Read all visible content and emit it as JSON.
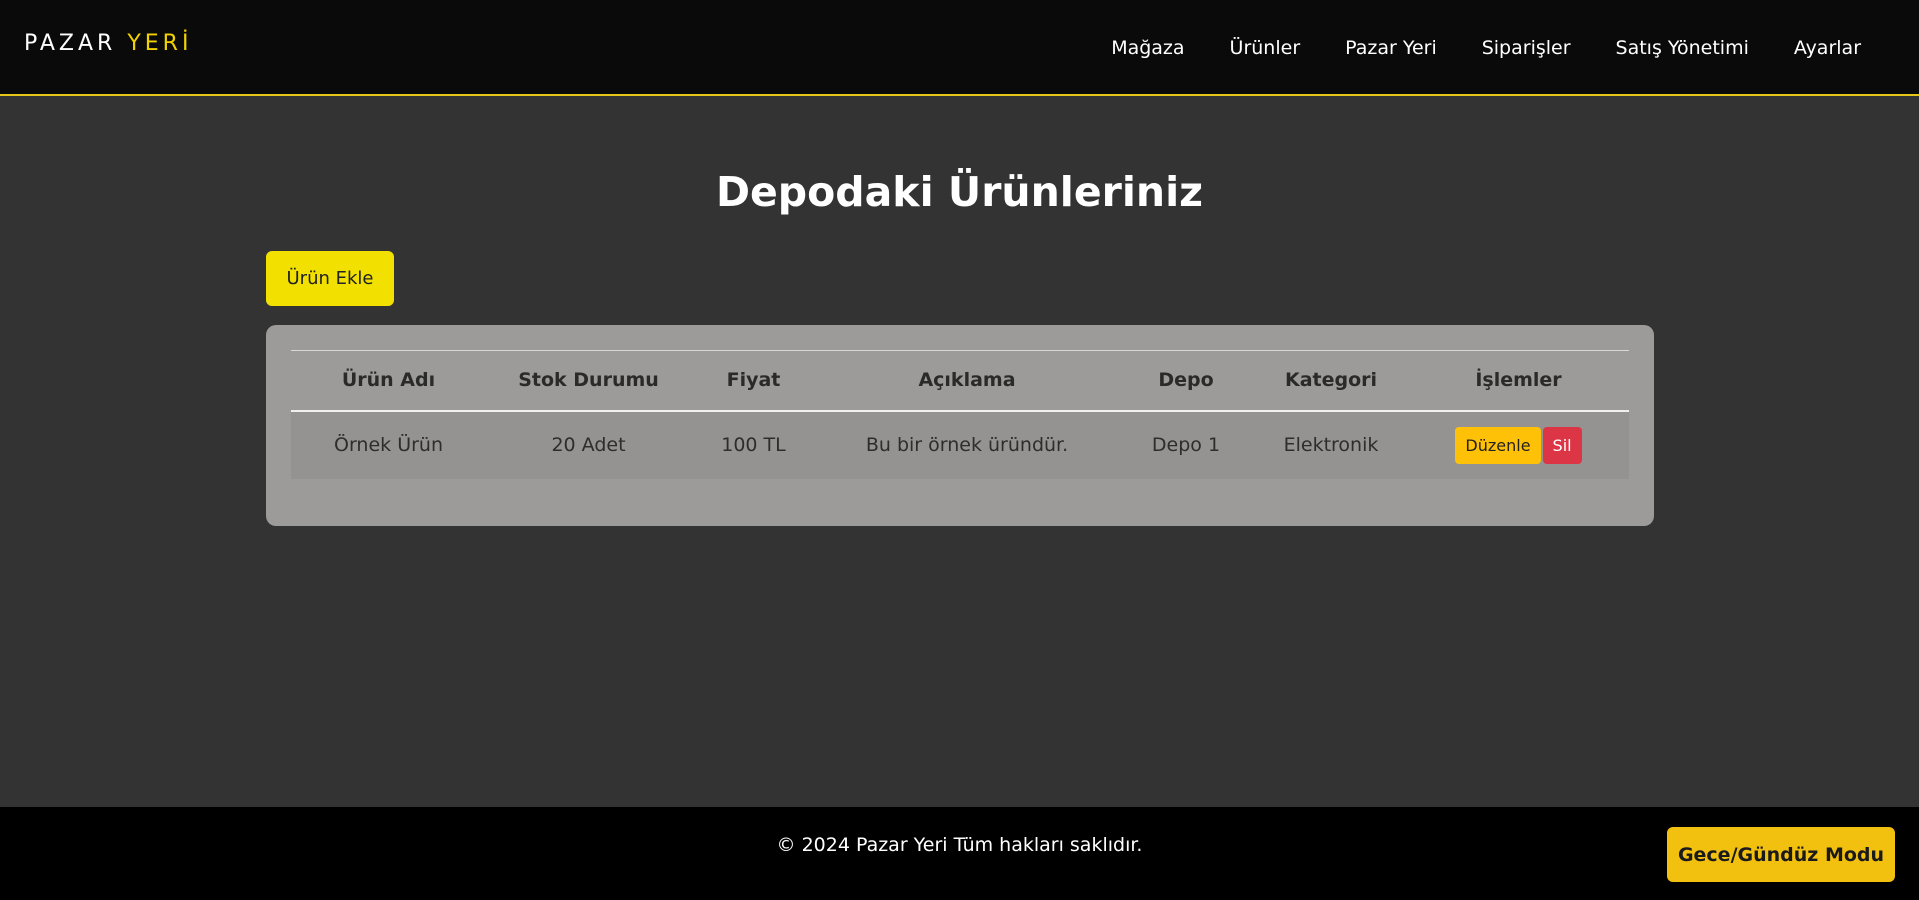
{
  "header": {
    "logo_main": "PAZAR",
    "logo_accent": "YERİ",
    "nav": [
      "Mağaza",
      "Ürünler",
      "Pazar Yeri",
      "Siparişler",
      "Satış Yönetimi",
      "Ayarlar"
    ]
  },
  "main": {
    "title": "Depodaki Ürünleriniz",
    "add_button": "Ürün Ekle",
    "table": {
      "columns": [
        "Ürün Adı",
        "Stok Durumu",
        "Fiyat",
        "Açıklama",
        "Depo",
        "Kategori",
        "İşlemler"
      ],
      "rows": [
        {
          "name": "Örnek Ürün",
          "stock": "20 Adet",
          "price": "100 TL",
          "description": "Bu bir örnek üründür.",
          "warehouse": "Depo 1",
          "category": "Elektronik",
          "edit_label": "Düzenle",
          "delete_label": "Sil"
        }
      ]
    }
  },
  "footer": {
    "copyright": "© 2024 Pazar Yeri Tüm hakları saklıdır.",
    "mode_button": "Gece/Gündüz Modu"
  },
  "colors": {
    "accent": "#f2e100",
    "edit": "#ffc107",
    "delete": "#dc3545",
    "header_border": "#e6c619"
  }
}
